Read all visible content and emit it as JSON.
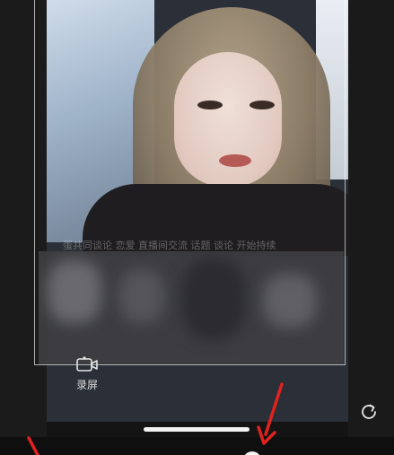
{
  "camera": {
    "ghost_text": "蛋共同谈论 恋爱 直播间交流 话题 谈论 开始持续"
  },
  "controls": {
    "record_label": "录屏",
    "record_icon": "screen-record-icon",
    "refresh_icon": "refresh-icon"
  },
  "annotations": {
    "arrow_color": "#e0221f"
  },
  "colors": {
    "background": "#141414",
    "frame": "#ffffff",
    "home_indicator": "#f2f2f2"
  }
}
